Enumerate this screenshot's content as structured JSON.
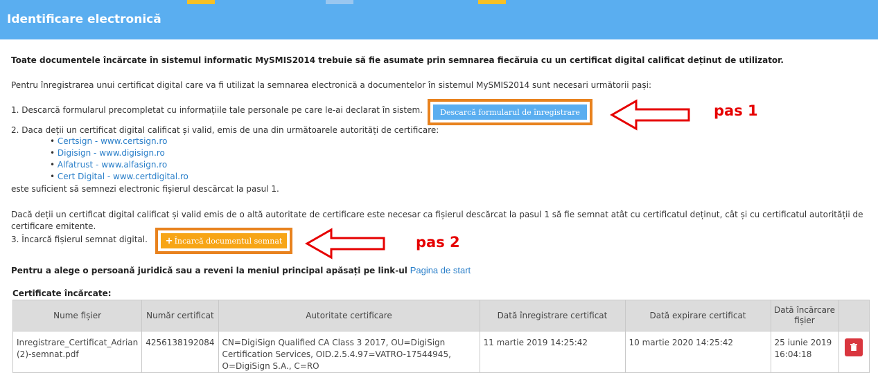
{
  "header": {
    "title": "Identificare electronică"
  },
  "intro": {
    "bold_text": "Toate documentele încărcate în sistemul informatic MySMIS2014 trebuie să fie asumate prin semnarea fiecăruia cu un certificat digital calificat deținut de utilizator.",
    "text": "Pentru înregistrarea unui certificat digital care va fi utilizat la semnarea electronică a documentelor în sistemul MySMIS2014 sunt necesari următorii pași:"
  },
  "steps": {
    "step1": "1. Descarcă formularul precompletat cu informațiile tale personale pe care le-ai declarat în sistem.",
    "download_button": "Descarcă formularul de înregistrare",
    "step2": "2. Daca deții un certificat digital calificat și valid, emis de una din următoarele autorități de certificare:",
    "authorities": [
      "Certsign - www.certsign.ro",
      "Digisign - www.digisign.ro",
      "Alfatrust - www.alfasign.ro",
      "Cert Digital - www.certdigital.ro"
    ],
    "step2_end": "este suficient să semnezi electronic fișierul descărcat la pasul 1.",
    "other_line1": "Dacă deții un certificat digital calificat și valid emis de o altă autoritate de certificare este necesar ca fișierul descărcat la pasul 1 să fie semnat atât cu certificatul deținut, cât și cu certificatul autorității de",
    "other_line2": "certificare emitente.",
    "step3": "3. Încarcă fișierul semnat digital.",
    "upload_button": "Încarcă documentul semnat",
    "upload_icon": "+"
  },
  "annotations": {
    "pas1": "pas 1",
    "pas2": "pas 2",
    "arrow_color": "#e60000"
  },
  "legal_entity": {
    "text": "Pentru a alege o persoană juridică sau a reveni la meniul principal apăsați pe link-ul",
    "link": "Pagina de start"
  },
  "certificates": {
    "heading": "Certificate încărcate:",
    "columns": [
      "Nume fișier",
      "Număr certificat",
      "Autoritate certificare",
      "Dată înregistrare certificat",
      "Dată expirare certificat",
      "Dată încărcare fișier",
      ""
    ],
    "rows": [
      {
        "file_name": "Inregistrare_Certificat_Adrian (2)-semnat.pdf",
        "number": "4256138192084",
        "authority": "CN=DigiSign Qualified CA Class 3 2017, OU=DigiSign Certification Services, OID.2.5.4.97=VATRO-17544945, O=DigiSign S.A., C=RO",
        "registered": "11 martie 2019 14:25:42",
        "expires": "10 martie 2020 14:25:42",
        "uploaded": "25 iunie 2019 16:04:18",
        "delete_icon": "trash-icon"
      }
    ]
  },
  "colors": {
    "header": "#5aaef0",
    "accent_orange": "#f7a516",
    "highlight_border": "#e8821e",
    "delete": "#d9363e"
  }
}
